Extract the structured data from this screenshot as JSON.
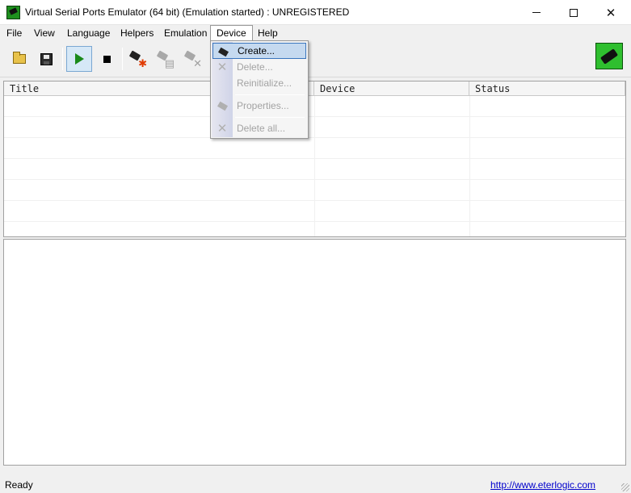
{
  "window": {
    "title": "Virtual Serial Ports Emulator (64 bit) (Emulation started) : UNREGISTERED",
    "app_icon": "serial-plug-icon",
    "controls": {
      "minimize": "minimize-icon",
      "maximize": "maximize-icon",
      "close": "close-icon",
      "close_glyph": "✕"
    }
  },
  "menubar": {
    "items": [
      "File",
      "View",
      "Language",
      "Helpers",
      "Emulation",
      "Device",
      "Help"
    ],
    "open_item": "Device"
  },
  "toolbar": {
    "buttons": [
      {
        "icon": "open-folder-icon",
        "enabled": true
      },
      {
        "icon": "save-disk-icon",
        "enabled": true
      },
      {
        "icon": "play-icon",
        "enabled": true,
        "pressed": true
      },
      {
        "icon": "stop-icon",
        "enabled": true
      },
      {
        "icon": "create-device-icon",
        "enabled": true
      },
      {
        "icon": "device-properties-icon",
        "enabled": false
      },
      {
        "icon": "delete-device-icon",
        "enabled": false
      }
    ],
    "logo_icon": "serial-connector-logo-icon"
  },
  "device_menu": {
    "items": [
      {
        "label": "Create...",
        "enabled": true,
        "highlighted": true,
        "icon": "create-device-icon"
      },
      {
        "label": "Delete...",
        "enabled": false,
        "icon": "delete-x-icon"
      },
      {
        "label": "Reinitialize...",
        "enabled": false,
        "icon": ""
      },
      {
        "label": "Properties...",
        "enabled": false,
        "icon": "device-properties-icon"
      },
      {
        "label": "Delete all...",
        "enabled": false,
        "icon": "delete-all-icon"
      }
    ]
  },
  "device_table": {
    "columns": [
      "Title",
      "Device",
      "Status"
    ],
    "rows": []
  },
  "statusbar": {
    "status": "Ready",
    "link": "http://www.eterlogic.com"
  },
  "colors": {
    "menu_highlight": "#c5d9ef",
    "menu_highlight_border": "#3a75bd",
    "link": "#0000cc",
    "play_green": "#1a8a1a"
  }
}
